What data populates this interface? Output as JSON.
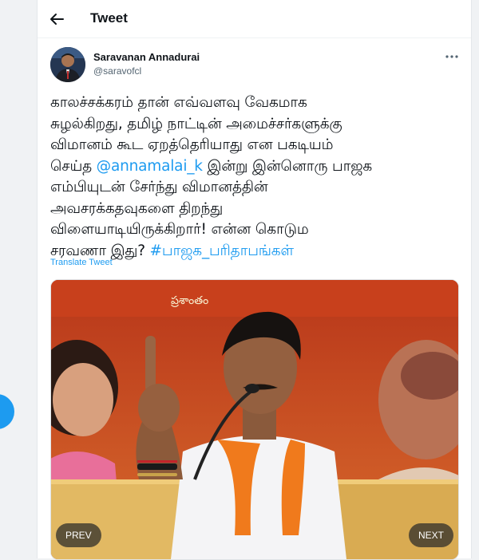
{
  "header": {
    "title": "Tweet"
  },
  "tweet": {
    "author_name": "Saravanan Annadurai",
    "author_handle": "@saravofcl",
    "line1": "காலச்சக்கரம் தான் எவ்வளவு வேகமாக",
    "line2": "சுழல்கிறது, தமிழ் நாட்டின் அமைச்சர்களுக்கு",
    "line3": "விமானம் கூட ஏறத்தெரியாது என பகடியம்",
    "line4_prefix": "செய்த",
    "mention": "@annamalai_k",
    "line4_suffix": "இன்று இன்னொரு பாஜக",
    "line5": "எம்பியுடன் சேர்ந்து விமானத்தின்",
    "line6": "அவசரக்கதவுகளை திறந்து",
    "line7": "விளையாடியிருக்கிறார்! என்ன கொடும",
    "line8_prefix": "சரவணா இது?",
    "hashtag": "#பாஜக_பரிதாபங்கள்",
    "translate_label": "Translate Tweet"
  },
  "media": {
    "banner_text": "ప్రశాంతం",
    "prev_label": "PREV",
    "next_label": "NEXT"
  },
  "colors": {
    "accent": "#1d9bf0",
    "banner": "#c2451e",
    "saffron": "#f07a1c"
  },
  "icons": {
    "back": "back-arrow-icon",
    "more": "more-icon"
  }
}
